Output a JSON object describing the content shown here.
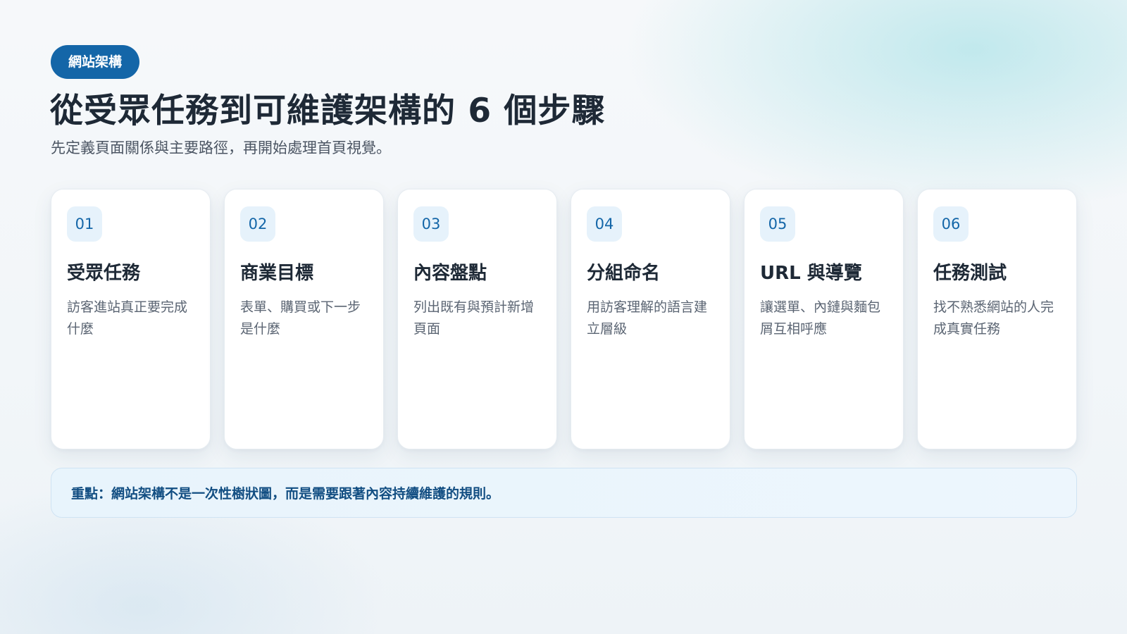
{
  "section_label": "網站架構",
  "title": "從受眾任務到可維護架構的 6 個步驟",
  "subtitle": "先定義頁面關係與主要路徑，再開始處理首頁視覺。",
  "steps": [
    {
      "number": "01",
      "title": "受眾任務",
      "description": "訪客進站真正要完成什麼"
    },
    {
      "number": "02",
      "title": "商業目標",
      "description": "表單、購買或下一步是什麼"
    },
    {
      "number": "03",
      "title": "內容盤點",
      "description": "列出既有與預計新增頁面"
    },
    {
      "number": "04",
      "title": "分組命名",
      "description": "用訪客理解的語言建立層級"
    },
    {
      "number": "05",
      "title": "URL 與導覽",
      "description": "讓選單、內鏈與麵包屑互相呼應"
    },
    {
      "number": "06",
      "title": "任務測試",
      "description": "找不熟悉網站的人完成真實任務"
    }
  ],
  "note": "重點：網站架構不是一次性樹狀圖，而是需要跟著內容持續維護的規則。",
  "colors": {
    "accent": "#1466a8",
    "number_badge_bg": "#e6f2fb",
    "note_bg": "#e8f4fc",
    "note_text": "#124e82",
    "title_text": "#1e2936",
    "body_text": "#5b6573"
  }
}
